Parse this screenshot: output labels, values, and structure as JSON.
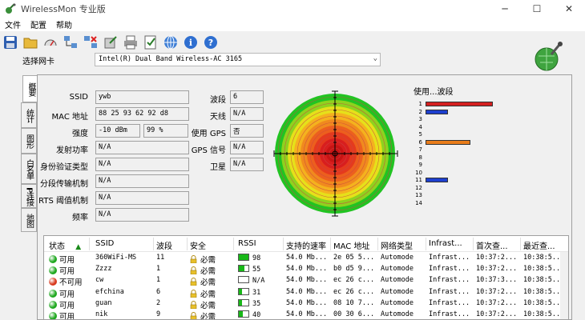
{
  "window": {
    "title": "WirelessMon 专业版",
    "min": "─",
    "max": "☐",
    "close": "✕"
  },
  "menu": [
    "文件",
    "配置",
    "帮助"
  ],
  "toolbar": [
    "save-icon",
    "folder-open-icon",
    "gauge-icon",
    "network-icon",
    "network-delete-icon",
    "export-icon",
    "print-icon",
    "checklist-icon",
    "globe-icon",
    "info-icon",
    "help-icon"
  ],
  "adapter": {
    "label": "选择网卡",
    "value": "Intel(R) Dual Band Wireless-AC 3165"
  },
  "tabs": [
    "概要",
    "统计",
    "图形",
    "白名单",
    "IP 连接",
    "地图"
  ],
  "info": {
    "ssid_label": "SSID",
    "ssid": "ywb",
    "mac_label": "MAC 地址",
    "mac": "88 25 93 62 92 d8",
    "strength_label": "强度",
    "strength_dbm": "-10 dBm",
    "strength_pct": "99 %",
    "txpower_label": "发射功率",
    "txpower": "N/A",
    "auth_label": "身份验证类型",
    "auth": "N/A",
    "frag_label": "分段传输机制",
    "frag": "N/A",
    "rts_label": "RTS 阈值机制",
    "rts": "N/A",
    "freq_label": "频率",
    "freq": "N/A",
    "channel_label": "波段",
    "channel": "6",
    "antenna_label": "天线",
    "antenna": "N/A",
    "gps_label": "使用 GPS",
    "gps": "否",
    "gps_signal_label": "GPS 信号",
    "gps_signal": "N/A",
    "satellite_label": "卫星",
    "satellite": "N/A"
  },
  "bands_title": "使用...波段",
  "band_usage": [
    {
      "n": "1",
      "value": 6,
      "color": "#d42020"
    },
    {
      "n": "2",
      "value": 2,
      "color": "#1d3fcf"
    },
    {
      "n": "3",
      "value": 0
    },
    {
      "n": "4",
      "value": 0
    },
    {
      "n": "5",
      "value": 0
    },
    {
      "n": "6",
      "value": 4,
      "color": "#e87c1a"
    },
    {
      "n": "7",
      "value": 0
    },
    {
      "n": "8",
      "value": 0
    },
    {
      "n": "9",
      "value": 0
    },
    {
      "n": "10",
      "value": 0
    },
    {
      "n": "11",
      "value": 2,
      "color": "#1d3fcf"
    },
    {
      "n": "12",
      "value": 0
    },
    {
      "n": "13",
      "value": 0
    },
    {
      "n": "14",
      "value": 0
    }
  ],
  "table": {
    "columns": [
      "状态",
      "SSID",
      "波段",
      "安全",
      "RSSI",
      "支持的速率",
      "MAC 地址",
      "网络类型",
      "Infrast...",
      "首次查...",
      "最近查..."
    ],
    "rows": [
      {
        "status": "可用",
        "status_color": "#1fa81f",
        "ssid": "360WiFi-MS",
        "channel": "11",
        "security": "必需",
        "rssi": "98",
        "rssi_fill": 0.98,
        "rate": "54.0 Mb...",
        "mac": "2e 05 5...",
        "type": "Automode",
        "infra": "Infrast...",
        "first": "10:37:2...",
        "last": "10:38:5..."
      },
      {
        "status": "可用",
        "status_color": "#1fa81f",
        "ssid": "Zzzz",
        "channel": "1",
        "security": "必需",
        "rssi": "55",
        "rssi_fill": 0.55,
        "rate": "54.0 Mb...",
        "mac": "b0 d5 9...",
        "type": "Automode",
        "infra": "Infrast...",
        "first": "10:37:2...",
        "last": "10:38:5..."
      },
      {
        "status": "不可用",
        "status_color": "#d83a1e",
        "ssid": "cw",
        "channel": "1",
        "security": "必需",
        "rssi": "N/A",
        "rssi_fill": 0,
        "rate": "54.0 Mb...",
        "mac": "ec 26 c...",
        "type": "Automode",
        "infra": "Infrast...",
        "first": "10:37:3...",
        "last": "10:38:5..."
      },
      {
        "status": "可用",
        "status_color": "#1fa81f",
        "ssid": "efchina",
        "channel": "6",
        "security": "必需",
        "rssi": "31",
        "rssi_fill": 0.31,
        "rate": "54.0 Mb...",
        "mac": "ec 26 c...",
        "type": "Automode",
        "infra": "Infrast...",
        "first": "10:37:2...",
        "last": "10:38:5..."
      },
      {
        "status": "可用",
        "status_color": "#1fa81f",
        "ssid": "guan",
        "channel": "2",
        "security": "必需",
        "rssi": "35",
        "rssi_fill": 0.35,
        "rate": "54.0 Mb...",
        "mac": "08 10 7...",
        "type": "Automode",
        "infra": "Infrast...",
        "first": "10:37:2...",
        "last": "10:38:5..."
      },
      {
        "status": "可用",
        "status_color": "#1fa81f",
        "ssid": "nik",
        "channel": "9",
        "security": "必需",
        "rssi": "40",
        "rssi_fill": 0.4,
        "rate": "54.0 Mb...",
        "mac": "00 30 6...",
        "type": "Automode",
        "infra": "Infrast...",
        "first": "10:37:2...",
        "last": "10:38:5..."
      }
    ]
  }
}
